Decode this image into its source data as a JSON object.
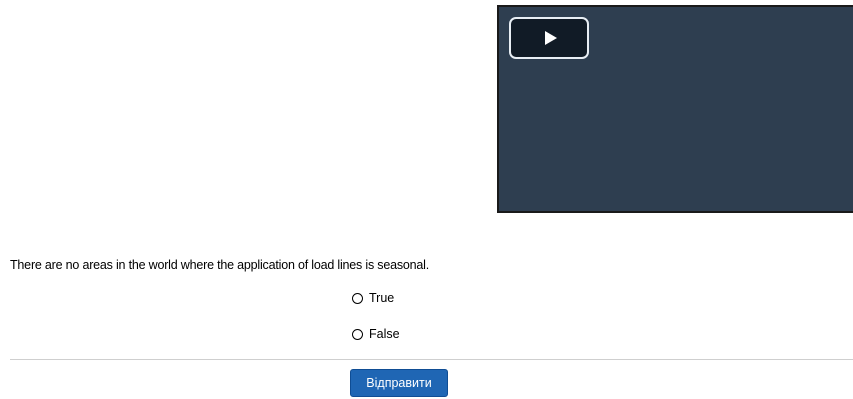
{
  "video": {
    "play_icon": "play-icon",
    "background_color": "#2e3e50"
  },
  "quiz": {
    "question": "There are no areas in the world where the application of load lines is seasonal.",
    "options": [
      {
        "label": "True",
        "selected": false
      },
      {
        "label": "False",
        "selected": false
      }
    ],
    "submit_label": "Відправити",
    "submit_color": "#1f66b4"
  }
}
